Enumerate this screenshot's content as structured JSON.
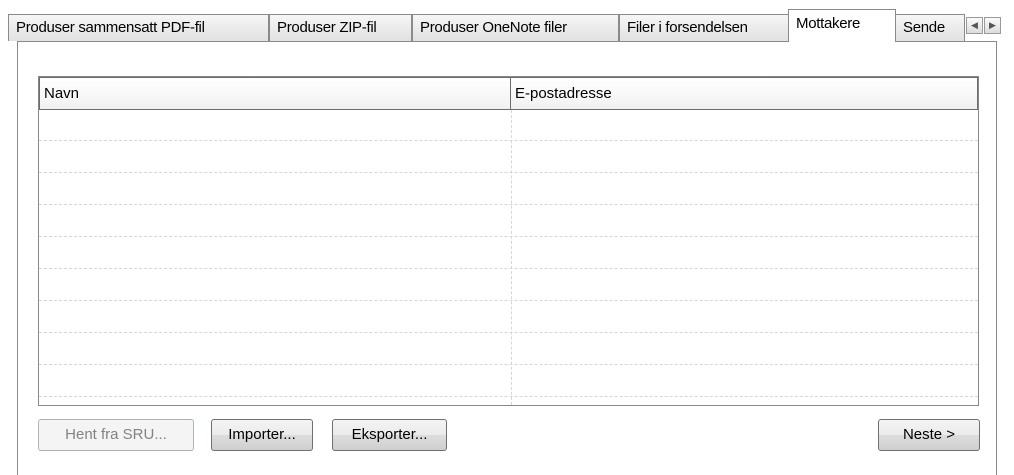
{
  "tabs": [
    {
      "label": "Produser sammensatt PDF-fil",
      "active": false
    },
    {
      "label": "Produser ZIP-fil",
      "active": false
    },
    {
      "label": "Produser OneNote filer",
      "active": false
    },
    {
      "label": "Filer i forsendelsen",
      "active": false
    },
    {
      "label": "Mottakere",
      "active": true
    },
    {
      "label": "Sende",
      "active": false
    }
  ],
  "tab_scroll": {
    "left_icon": "arrow-left-icon",
    "right_icon": "arrow-right-icon",
    "left_glyph": "◀",
    "right_glyph": "▶"
  },
  "list": {
    "columns": [
      "Navn",
      "E-postadresse"
    ],
    "rows": []
  },
  "buttons": {
    "fetch_sru": "Hent fra SRU...",
    "import": "Importer...",
    "export": "Eksporter...",
    "next": "Neste >"
  }
}
